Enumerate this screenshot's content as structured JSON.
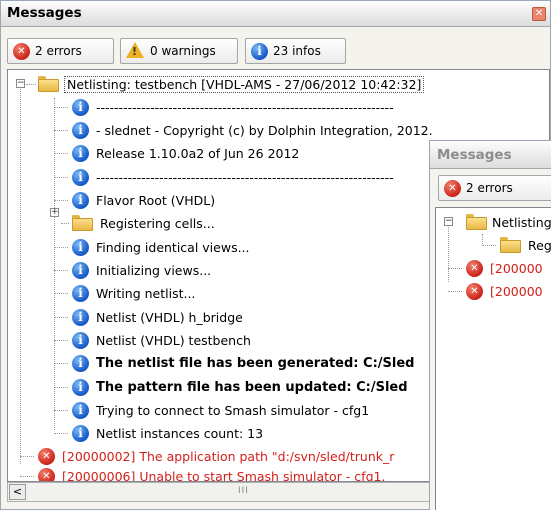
{
  "main": {
    "title": "Messages",
    "close_glyph": "✕",
    "toolbar": {
      "errors_label": "2 errors",
      "warnings_label": "0 warnings",
      "infos_label": "23 infos"
    },
    "tree": {
      "root_label": "Netlisting: testbench [VHDL-AMS - 27/06/2012 10:42:32]",
      "rows": [
        {
          "icon": "info-icon",
          "text": "------------------------------------------------------------------"
        },
        {
          "icon": "info-icon",
          "text": "- slednet - Copyright (c) by Dolphin Integration, 2012."
        },
        {
          "icon": "info-icon",
          "text": " Release 1.10.0a2 of Jun 26 2012"
        },
        {
          "icon": "info-icon",
          "text": "------------------------------------------------------------------"
        },
        {
          "icon": "info-icon",
          "text": "Flavor Root (VHDL)"
        },
        {
          "icon": "folder-icon",
          "text": "Registering cells..."
        },
        {
          "icon": "info-icon",
          "text": "Finding identical views..."
        },
        {
          "icon": "info-icon",
          "text": "Initializing views..."
        },
        {
          "icon": "info-icon",
          "text": "Writing netlist..."
        },
        {
          "icon": "info-icon",
          "text": " Netlist (VHDL) h_bridge"
        },
        {
          "icon": "info-icon",
          "text": " Netlist (VHDL) testbench"
        },
        {
          "icon": "info-icon",
          "text": "The netlist file has been generated: C:/Sled",
          "style": "bold"
        },
        {
          "icon": "info-icon",
          "text": "The pattern file has been updated: C:/Sled",
          "style": "bold"
        },
        {
          "icon": "info-icon",
          "text": "Trying to connect to Smash simulator - cfg1"
        },
        {
          "icon": "info-icon",
          "text": "Netlist instances count: 13"
        }
      ],
      "errors": [
        {
          "icon": "error-icon",
          "text": "[20000002] The application path \"d:/svn/sled/trunk_r"
        },
        {
          "icon": "error-icon",
          "text": "[20000006] Unable to start Smash simulator - cfg1."
        }
      ]
    },
    "scrollbar": {
      "left_arrow": "<",
      "grip": "III"
    }
  },
  "secondary": {
    "title": "Messages",
    "errors_label": "2 errors",
    "tree": {
      "root_label": "Netlisting",
      "child_label": "Regi",
      "errors": [
        "[200000",
        "[200000"
      ]
    }
  }
}
